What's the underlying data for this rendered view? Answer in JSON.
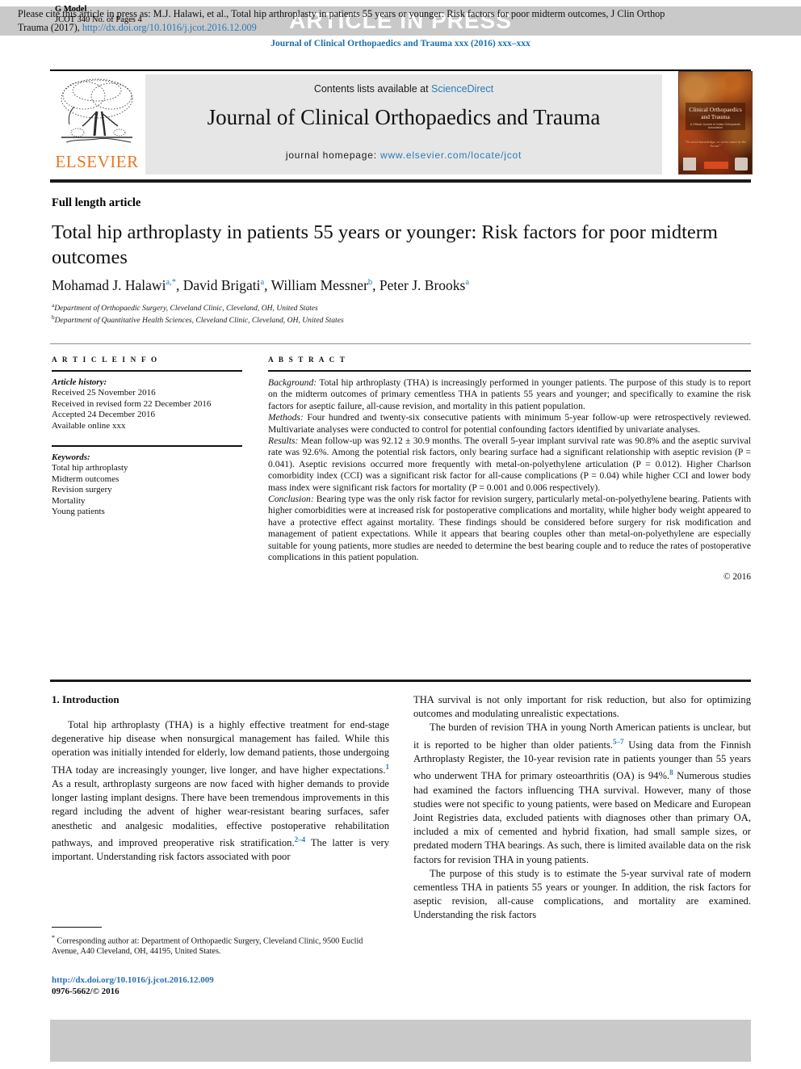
{
  "header": {
    "g_model_line1": "G Model",
    "g_model_line2": "JCOT 340 No. of Pages 4",
    "press_banner": "ARTICLE IN PRESS",
    "journal_ref": "Journal of Clinical Orthopaedics and Trauma xxx (2016) xxx–xxx"
  },
  "masthead": {
    "contents_prefix": "Contents lists available at ",
    "sciencedirect": "ScienceDirect",
    "journal_title": "Journal of Clinical Orthopaedics and Trauma",
    "homepage_prefix": "journal homepage: ",
    "homepage_url": "www.elsevier.com/locate/jcot",
    "publisher": "ELSEVIER",
    "cover": {
      "title_line1": "Clinical Orthopaedics",
      "title_line2": "and Trauma",
      "subtitle": "A Official Journal of Indian Orthopaedic Association",
      "tagline": "\"To serve knowledge, to serve more in the Serial\""
    }
  },
  "article": {
    "type": "Full length article",
    "title": "Total hip arthroplasty in patients 55 years or younger: Risk factors for poor midterm outcomes",
    "authors_html": "Mohamad J. Halawi<sup>a,*</sup>, David Brigati<sup>a</sup>, William Messner<sup>b</sup>, Peter J. Brooks<sup>a</sup>",
    "affiliation_a": "Department of Orthopaedic Surgery, Cleveland Clinic, Cleveland, OH, United States",
    "affiliation_b": "Department of Quantitative Health Sciences, Cleveland Clinic, Cleveland, OH, United States"
  },
  "article_info": {
    "heading": "A R T I C L E   I N F O",
    "history_label": "Article history:",
    "history": [
      "Received 25 November 2016",
      "Received in revised form 22 December 2016",
      "Accepted 24 December 2016",
      "Available online xxx"
    ],
    "keywords_label": "Keywords:",
    "keywords": [
      "Total hip arthroplasty",
      "Midterm outcomes",
      "Revision surgery",
      "Mortality",
      "Young patients"
    ]
  },
  "abstract": {
    "heading": "A B S T R A C T",
    "background_label": "Background:",
    "background": " Total hip arthroplasty (THA) is increasingly performed in younger patients. The purpose of this study is to report on the midterm outcomes of primary cementless THA in patients 55 years and younger; and specifically to examine the risk factors for aseptic failure, all-cause revision, and mortality in this patient population.",
    "methods_label": "Methods:",
    "methods": " Four hundred and twenty-six consecutive patients with minimum 5-year follow-up were retrospectively reviewed. Multivariate analyses were conducted to control for potential confounding factors identified by univariate analyses.",
    "results_label": "Results:",
    "results": " Mean follow-up was 92.12 ± 30.9 months. The overall 5-year implant survival rate was 90.8% and the aseptic survival rate was 92.6%. Among the potential risk factors, only bearing surface had a significant relationship with aseptic revision (P = 0.041). Aseptic revisions occurred more frequently with metal-on-polyethylene articulation (P = 0.012). Higher Charlson comorbidity index (CCI) was a significant risk factor for all-cause complications (P = 0.04) while higher CCI and lower body mass index were significant risk factors for mortality (P = 0.001 and 0.006 respectively).",
    "conclusion_label": "Conclusion:",
    "conclusion": " Bearing type was the only risk factor for revision surgery, particularly metal-on-polyethylene bearing. Patients with higher comorbidities were at increased risk for postoperative complications and mortality, while higher body weight appeared to have a protective effect against mortality. These findings should be considered before surgery for risk modification and management of patient expectations. While it appears that bearing couples other than metal-on-polyethylene are especially suitable for young patients, more studies are needed to determine the best bearing couple and to reduce the rates of postoperative complications in this patient population.",
    "copyright": "© 2016"
  },
  "introduction": {
    "heading": "1. Introduction",
    "left_para1_part1": "Total hip arthroplasty (THA) is a highly effective treatment for end-stage degenerative hip disease when nonsurgical management has failed. While this operation was initially intended for elderly, low demand patients, those undergoing THA today are increasingly younger, live longer, and have higher expectations.",
    "left_ref1": "1",
    "left_para1_part2": " As a result, arthroplasty surgeons are now faced with higher demands to provide longer lasting implant designs. There have been tremendous improvements in this regard including the advent of higher wear-resistant bearing surfaces, safer anesthetic and analgesic modalities, effective postoperative rehabilitation pathways, and improved preoperative risk stratification.",
    "left_ref2": "2–4",
    "left_para1_part3": " The latter is very important. Understanding risk factors associated with poor",
    "right_para1": "THA survival is not only important for risk reduction, but also for optimizing outcomes and modulating unrealistic expectations.",
    "right_para2_part1": "The burden of revision THA in young North American patients is unclear, but it is reported to be higher than older patients.",
    "right_ref1": "5–7",
    "right_para2_part2": " Using data from the Finnish Arthroplasty Register, the 10-year revision rate in patients younger than 55 years who underwent THA for primary osteoarthritis (OA) is 94%.",
    "right_ref2": "8",
    "right_para2_part3": " Numerous studies had examined the factors influencing THA survival. However, many of those studies were not specific to young patients, were based on Medicare and European Joint Registries data, excluded patients with diagnoses other than primary OA, included a mix of cemented and hybrid fixation, had small sample sizes, or predated modern THA bearings. As such, there is limited available data on the risk factors for revision THA in young patients.",
    "right_para3": "The purpose of this study is to estimate the 5-year survival rate of modern cementless THA in patients 55 years or younger. In addition, the risk factors for aseptic revision, all-cause complications, and mortality are examined. Understanding the risk factors"
  },
  "footnote": {
    "marker": "*",
    "text": " Corresponding author at: Department of Orthopaedic Surgery, Cleveland Clinic, 9500 Euclid Avenue, A40 Cleveland, OH, 44195, United States."
  },
  "doi_block": {
    "doi_url": "http://dx.doi.org/10.1016/j.jcot.2016.12.009",
    "issn_line": "0976-5662/© 2016"
  },
  "citation_footer": {
    "text_part1": "Please cite this article in press as: M.J. Halawi, et al., Total hip arthroplasty in patients 55 years or younger: Risk factors for poor midterm outcomes, J Clin Orthop Trauma (2017), ",
    "link": "http://dx.doi.org/10.1016/j.jcot.2016.12.009"
  },
  "colors": {
    "link_blue": "#2a7ab9",
    "elsevier_orange": "#e87722",
    "band_gray": "#c9c9c9",
    "mast_gray": "#e6e6e6"
  }
}
